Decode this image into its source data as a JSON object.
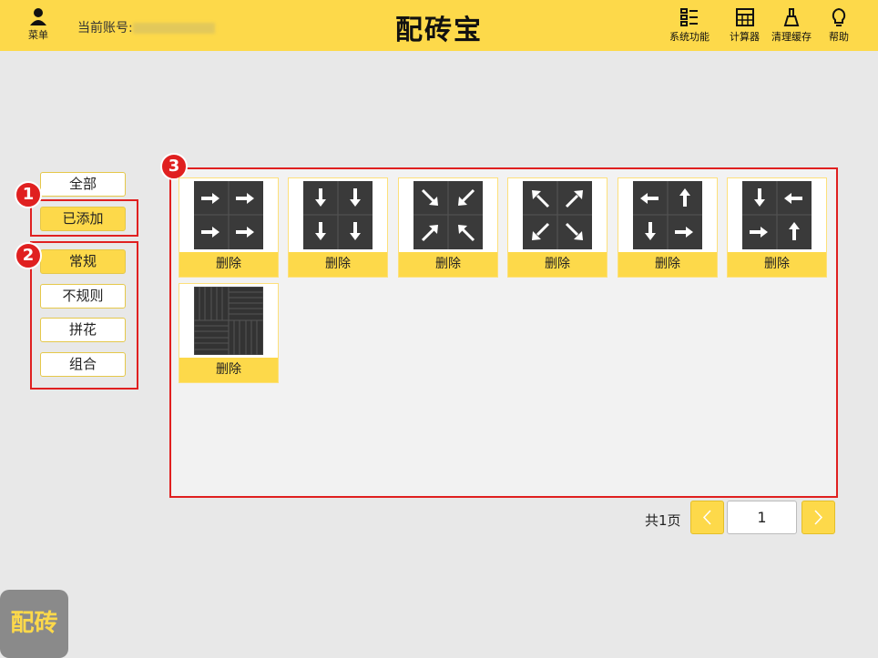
{
  "header": {
    "menu_label": "菜单",
    "account_label": "当前账号:",
    "app_title": "配砖宝",
    "tools": [
      {
        "label": "系统功能",
        "icon": "list-icon"
      },
      {
        "label": "计算器",
        "icon": "calculator-icon"
      },
      {
        "label": "清理缓存",
        "icon": "broom-icon"
      },
      {
        "label": "帮助",
        "icon": "lightbulb-icon"
      }
    ]
  },
  "annotations": [
    "1",
    "2",
    "3"
  ],
  "sidebar": {
    "filter": [
      {
        "label": "全部",
        "active": false
      },
      {
        "label": "已添加",
        "active": true
      }
    ],
    "types": [
      {
        "label": "常规",
        "active": true
      },
      {
        "label": "不规则",
        "active": false
      },
      {
        "label": "拼花",
        "active": false
      },
      {
        "label": "组合",
        "active": false
      }
    ]
  },
  "tiles": [
    {
      "pattern": "arrows-right",
      "action": "删除"
    },
    {
      "pattern": "arrows-down",
      "action": "删除"
    },
    {
      "pattern": "arrows-inward-diagonal",
      "action": "删除"
    },
    {
      "pattern": "arrows-outward-diagonal",
      "action": "删除"
    },
    {
      "pattern": "arrows-mixed-cycle",
      "action": "删除"
    },
    {
      "pattern": "arrows-mixed-rotate",
      "action": "删除"
    },
    {
      "pattern": "herringbone-parquet",
      "action": "删除"
    }
  ],
  "pagination": {
    "total_label": "共1页",
    "current_page": "1"
  },
  "fab_label": "配砖",
  "colors": {
    "accent": "#fdd94a",
    "highlight": "#e02020",
    "tile": "#3a3a3a"
  }
}
